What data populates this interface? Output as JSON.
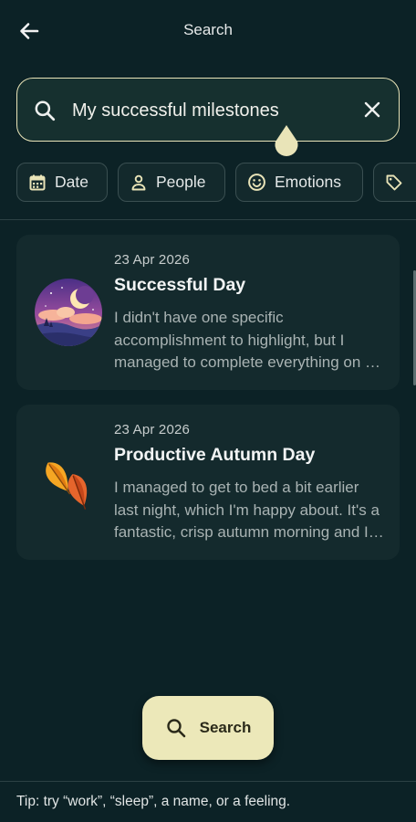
{
  "header": {
    "title": "Search",
    "back_icon": "arrow-left-icon"
  },
  "search": {
    "value": "My successful milestones",
    "placeholder": "",
    "search_icon": "search-icon",
    "clear_icon": "close-icon"
  },
  "filters": [
    {
      "label": "Date",
      "icon": "calendar-icon"
    },
    {
      "label": "People",
      "icon": "person-icon"
    },
    {
      "label": "Emotions",
      "icon": "smile-icon"
    },
    {
      "label": "",
      "icon": "tag-icon"
    }
  ],
  "results": [
    {
      "date": "23 Apr 2026",
      "title": "Successful Day",
      "excerpt": "I didn't have one specific accomplishment to highlight, but I managed to complete everything on my list today and felt good about it.",
      "thumbnail": "night-moon-illustration"
    },
    {
      "date": "23 Apr 2026",
      "title": "Productive Autumn Day",
      "excerpt": "I managed to get to bed a bit earlier last night, which I'm happy about. It's a fantastic, crisp autumn morning and I got a lot done.",
      "thumbnail": "autumn-leaves-icon"
    }
  ],
  "fab": {
    "label": "Search",
    "icon": "search-icon"
  },
  "tip": "Tip: try “work”, “sleep”, a name, or a feeling.",
  "colors": {
    "background": "#0c2226",
    "card": "#142a2d",
    "accent": "#ece8b9",
    "border_focus": "#e9e4b8"
  }
}
